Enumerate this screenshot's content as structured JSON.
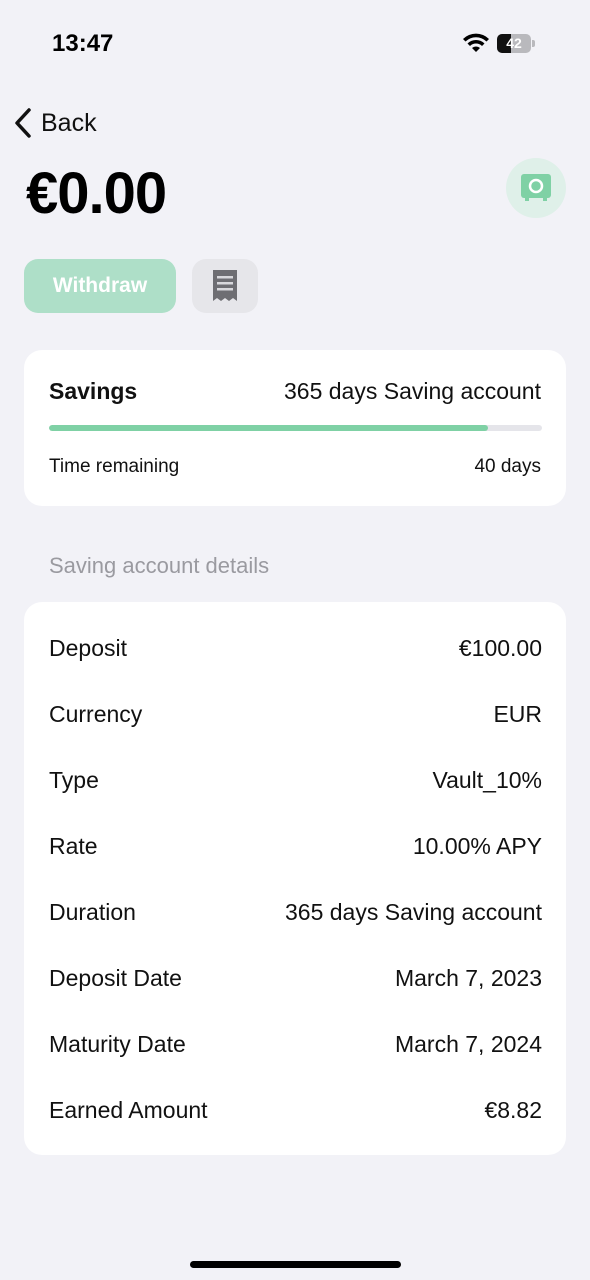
{
  "status_bar": {
    "time": "13:47",
    "battery_level": "42"
  },
  "nav": {
    "back_label": "Back"
  },
  "header": {
    "balance": "€0.00"
  },
  "actions": {
    "withdraw_label": "Withdraw"
  },
  "savings": {
    "title": "Savings",
    "account_type": "365 days Saving account",
    "progress": 0.89,
    "time_remaining_label": "Time remaining",
    "time_remaining_value": "40 days"
  },
  "details": {
    "section_title": "Saving account details",
    "rows": [
      {
        "label": "Deposit",
        "value": "€100.00"
      },
      {
        "label": "Currency",
        "value": "EUR"
      },
      {
        "label": "Type",
        "value": "Vault_10%"
      },
      {
        "label": "Rate",
        "value": "10.00% APY"
      },
      {
        "label": "Duration",
        "value": "365 days Saving account"
      },
      {
        "label": "Deposit Date",
        "value": "March 7, 2023"
      },
      {
        "label": "Maturity Date",
        "value": "March 7, 2024"
      },
      {
        "label": "Earned Amount",
        "value": "€8.82"
      }
    ]
  },
  "colors": {
    "accent": "#7fd1a5",
    "withdraw_disabled": "#aedfc8",
    "background": "#f2f2f7"
  }
}
